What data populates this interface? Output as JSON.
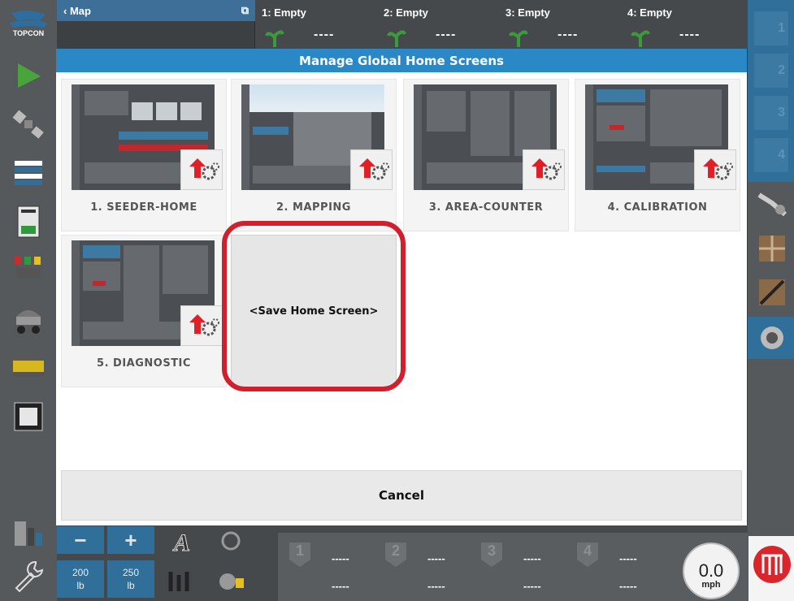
{
  "modal": {
    "title": "Manage Global Home Screens",
    "tiles": [
      {
        "label": "1. SEEDER-HOME"
      },
      {
        "label": "2. MAPPING"
      },
      {
        "label": "3. AREA-COUNTER"
      },
      {
        "label": "4. CALIBRATION"
      },
      {
        "label": "5. DIAGNOSTIC"
      }
    ],
    "save_label": "<Save Home Screen>",
    "cancel_label": "Cancel"
  },
  "top_bar": {
    "map_label": "‹ Map",
    "channels": [
      {
        "title": "1: Empty",
        "value": "----"
      },
      {
        "title": "2: Empty",
        "value": "----"
      },
      {
        "title": "3: Empty",
        "value": "----"
      },
      {
        "title": "4: Empty",
        "value": "----"
      }
    ]
  },
  "right_bar": {
    "section_numbers": [
      "1",
      "2",
      "3",
      "4"
    ]
  },
  "bottom_bar": {
    "rate_1": {
      "value": "200",
      "unit": "lb"
    },
    "rate_2": {
      "value": "250",
      "unit": "lb"
    },
    "sections": [
      {
        "num": "1",
        "top": "-----",
        "bottom": "-----"
      },
      {
        "num": "2",
        "top": "-----",
        "bottom": "-----"
      },
      {
        "num": "3",
        "top": "-----",
        "bottom": "-----"
      },
      {
        "num": "4",
        "top": "-----",
        "bottom": "-----"
      }
    ],
    "speed_value": "0.0",
    "speed_unit": "mph"
  },
  "colors": {
    "title_bar": "#2a88c7",
    "accent_blue": "#2f6f99",
    "highlight_red": "#d0202e"
  },
  "icons": {
    "logo": "topcon-logo",
    "gear": "gear-icon",
    "upload": "red-arrow-icon"
  }
}
